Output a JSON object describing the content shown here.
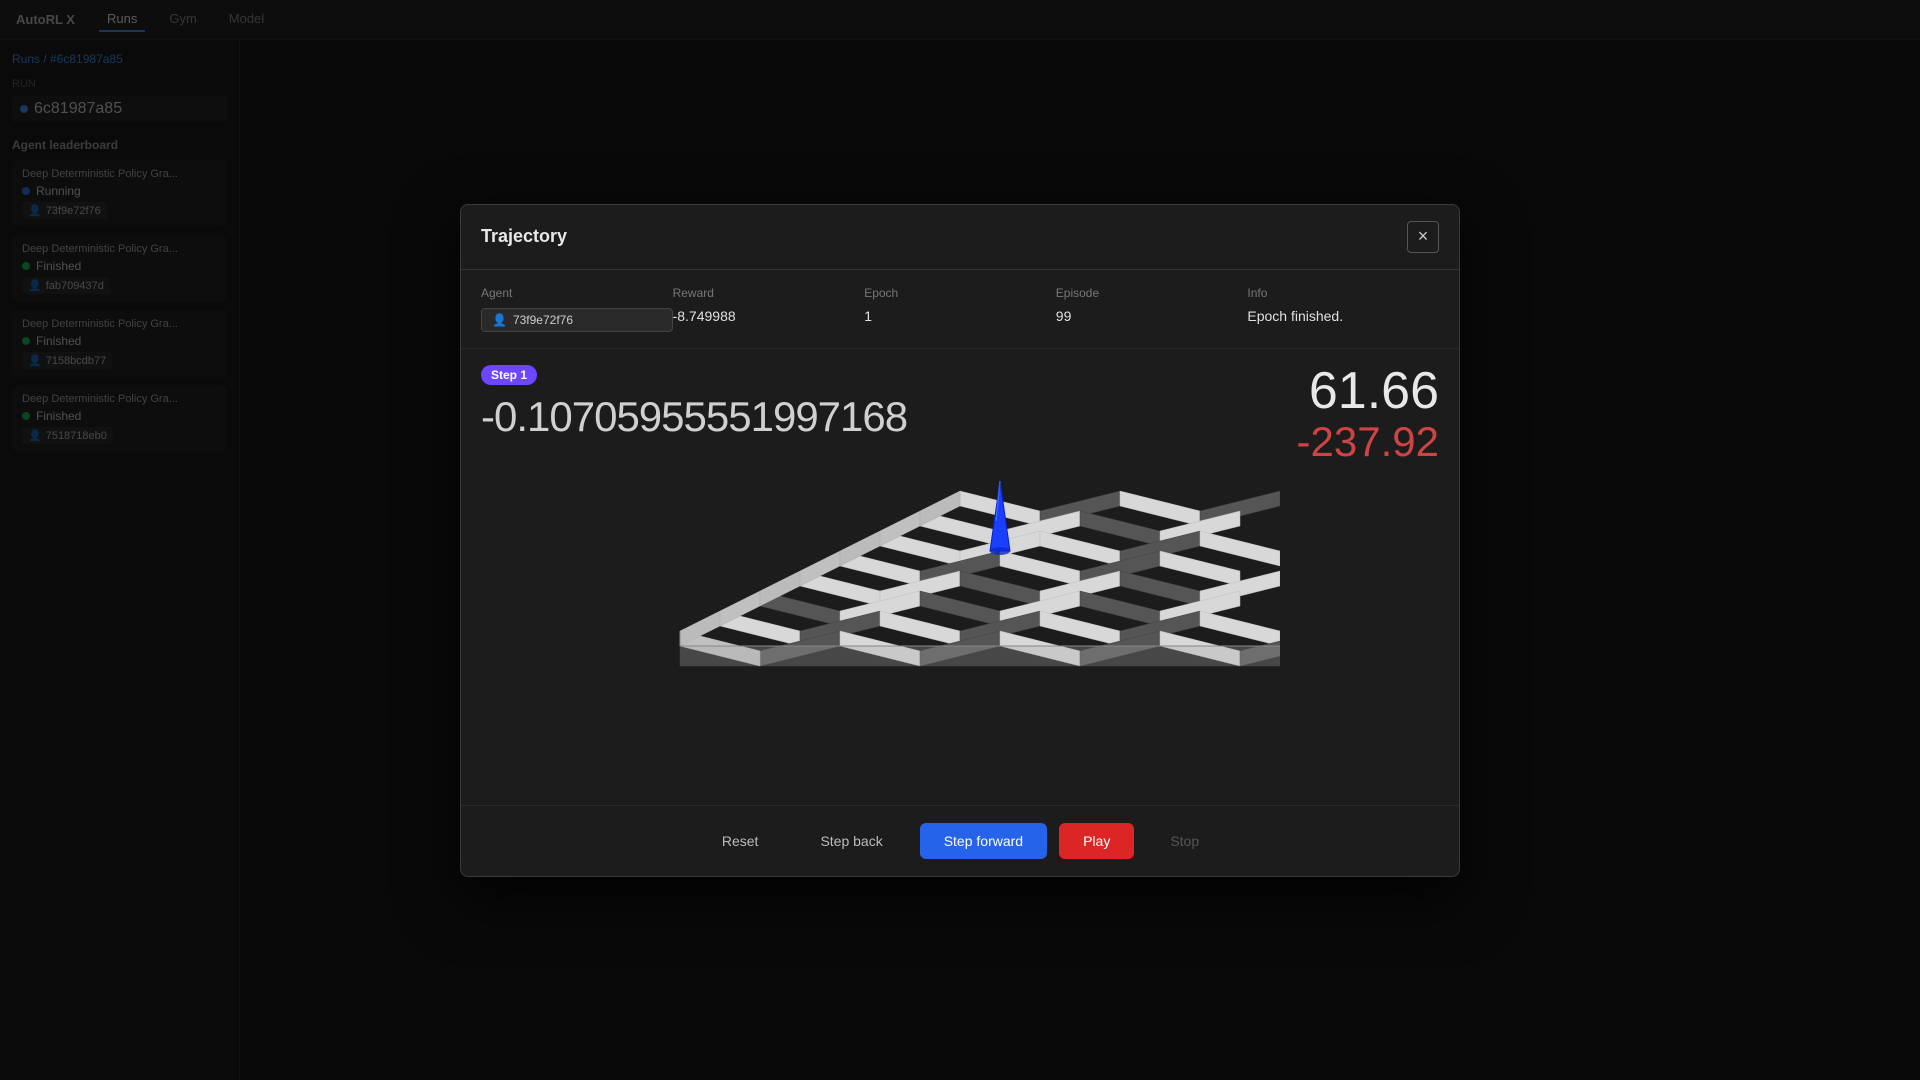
{
  "app": {
    "title": "AutoRL X",
    "tabs": [
      {
        "label": "Runs",
        "active": true
      },
      {
        "label": "Gym",
        "active": false
      },
      {
        "label": "Model",
        "active": false
      }
    ]
  },
  "sidebar": {
    "breadcrumb": {
      "runs_label": "Runs",
      "separator": "/",
      "run_id": "#6c81987a85"
    },
    "run_section": "Run",
    "run_badge": "6c81987a85",
    "agent_leaderboard": "Agent leaderboard",
    "agents": [
      {
        "title": "Deep Deterministic Policy Gra...",
        "status": "running",
        "status_label": "Running",
        "id": "73f9e72f76"
      },
      {
        "title": "Deep Deterministic Policy Gra...",
        "status": "finished",
        "status_label": "Finished",
        "id": "fab709437d"
      },
      {
        "title": "Deep Deterministic Policy Gra...",
        "status": "finished",
        "status_label": "Finished",
        "id": "7158bcdb77"
      },
      {
        "title": "Deep Deterministic Policy Gra...",
        "status": "finished",
        "status_label": "Finished",
        "id": "7518718eb0"
      }
    ]
  },
  "modal": {
    "title": "Trajectory",
    "close_label": "×",
    "info": {
      "agent_label": "Agent",
      "agent_id": "73f9e72f76",
      "reward_label": "Reward",
      "reward_value": "-8.749988",
      "epoch_label": "Epoch",
      "epoch_value": "1",
      "episode_label": "Episode",
      "episode_value": "99",
      "info_label": "Info",
      "info_value": "Epoch finished."
    },
    "step_badge": "Step 1",
    "main_number": "-0.10705955551997168",
    "stat_top": "61.66",
    "stat_bottom": "-237.92",
    "buttons": {
      "reset": "Reset",
      "step_back": "Step back",
      "step_forward": "Step forward",
      "play": "Play",
      "stop": "Stop"
    },
    "grid": {
      "cols": 8,
      "rows": 6,
      "dark_cells": [
        [
          1,
          0
        ],
        [
          3,
          0
        ],
        [
          5,
          0
        ],
        [
          6,
          0
        ],
        [
          0,
          1
        ],
        [
          2,
          1
        ],
        [
          4,
          1
        ],
        [
          6,
          1
        ],
        [
          1,
          2
        ],
        [
          3,
          2
        ],
        [
          5,
          2
        ],
        [
          7,
          2
        ],
        [
          0,
          3
        ],
        [
          2,
          3
        ],
        [
          4,
          3
        ],
        [
          6,
          3
        ],
        [
          1,
          4
        ],
        [
          3,
          4
        ],
        [
          5,
          4
        ],
        [
          7,
          4
        ],
        [
          0,
          5
        ],
        [
          2,
          5
        ],
        [
          4,
          5
        ],
        [
          6,
          5
        ]
      ]
    }
  }
}
